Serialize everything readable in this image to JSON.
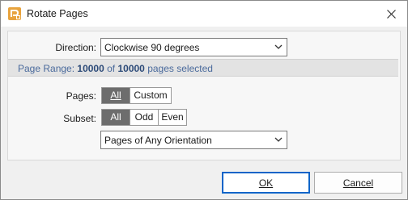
{
  "window": {
    "title": "Rotate Pages"
  },
  "direction": {
    "label": "Direction:",
    "value": "Clockwise 90 degrees"
  },
  "page_range": {
    "prefix": "Page Range:",
    "current": "10000",
    "middle": "of",
    "total": "10000",
    "suffix": "pages selected"
  },
  "pages": {
    "label": "Pages:",
    "options": [
      {
        "label": "All",
        "selected": true
      },
      {
        "label": "Custom",
        "selected": false
      }
    ]
  },
  "subset": {
    "label": "Subset:",
    "options": [
      {
        "label": "All",
        "selected": true
      },
      {
        "label": "Odd",
        "selected": false
      },
      {
        "label": "Even",
        "selected": false
      }
    ],
    "orientation_value": "Pages of Any Orientation"
  },
  "buttons": {
    "ok": "OK",
    "cancel": "Cancel"
  },
  "colors": {
    "accent": "#0a64c8",
    "selected_segment": "#6d6d6d",
    "range_text": "#4a6a9c",
    "icon": "#e8a33d"
  }
}
